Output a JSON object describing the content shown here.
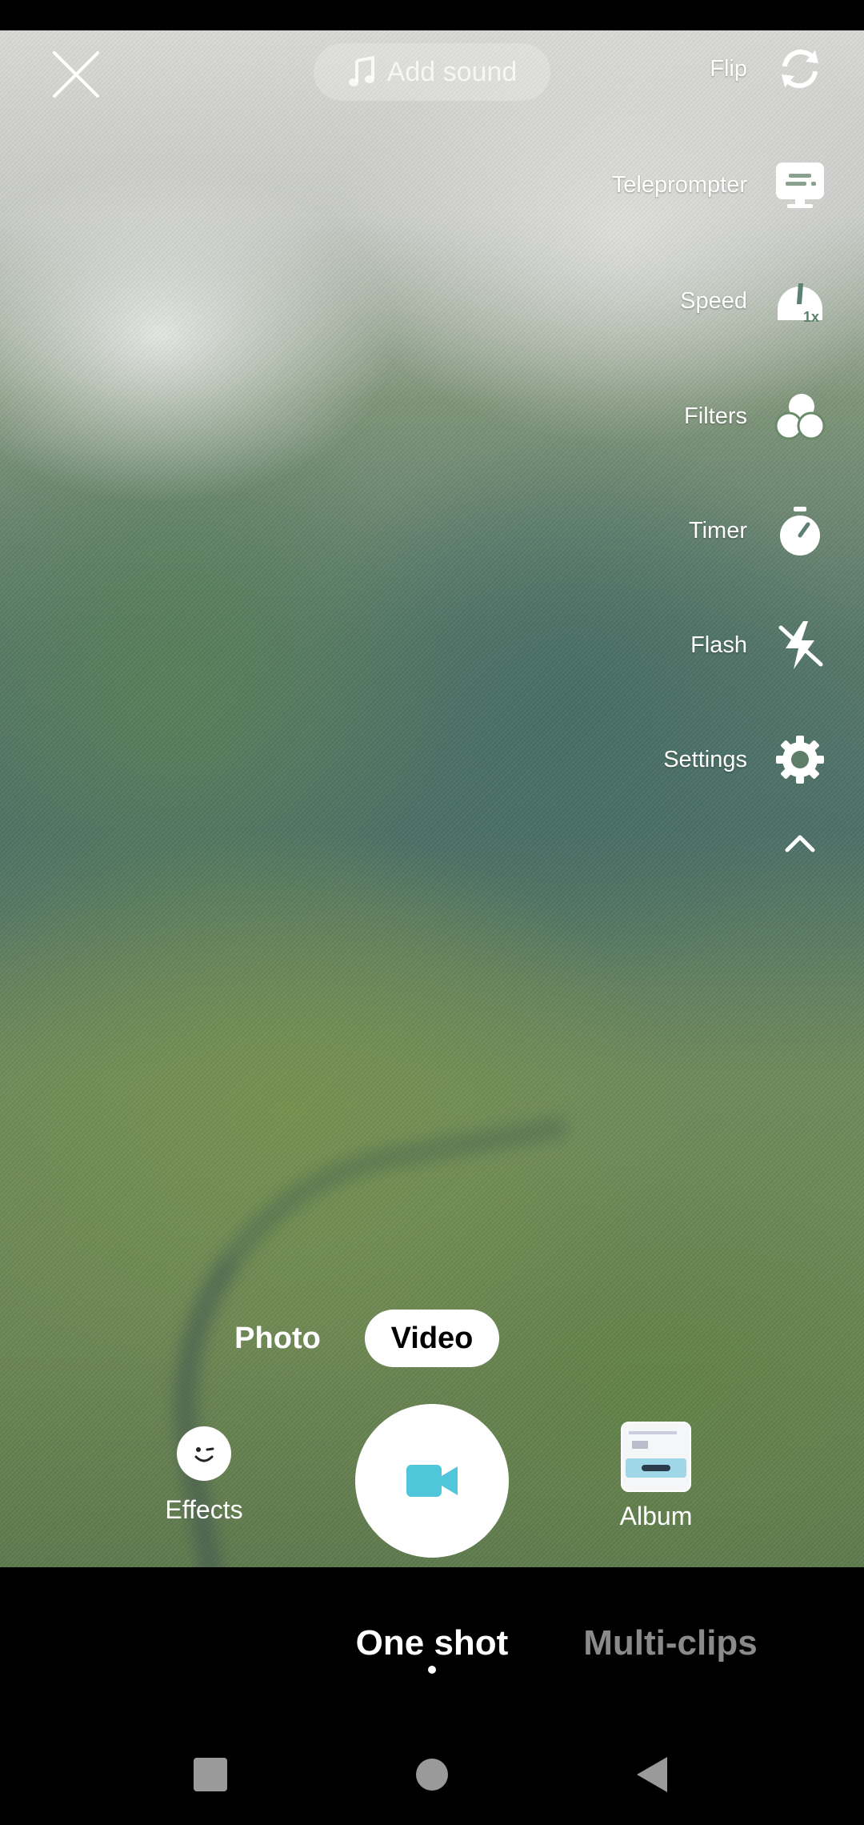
{
  "topbar": {
    "add_sound_label": "Add sound"
  },
  "side_rail": [
    {
      "label": "Flip",
      "icon": "flip-icon"
    },
    {
      "label": "Teleprompter",
      "icon": "teleprompter-icon"
    },
    {
      "label": "Speed",
      "icon": "speed-icon",
      "badge": "1x"
    },
    {
      "label": "Filters",
      "icon": "filters-icon"
    },
    {
      "label": "Timer",
      "icon": "timer-icon"
    },
    {
      "label": "Flash",
      "icon": "flash-off-icon"
    },
    {
      "label": "Settings",
      "icon": "gear-icon"
    }
  ],
  "collapse_icon": "chevron-up-icon",
  "modes": {
    "photo": "Photo",
    "video": "Video",
    "selected": "Video"
  },
  "capture": {
    "effects_label": "Effects",
    "album_label": "Album",
    "shutter_icon": "video-camera-icon",
    "accent_color": "#4fc6d9"
  },
  "tabs": {
    "one_shot": "One shot",
    "multi_clips": "Multi-clips",
    "selected": "One shot"
  },
  "system_nav": {
    "recents": "square-icon",
    "home": "circle-icon",
    "back": "triangle-back-icon"
  }
}
